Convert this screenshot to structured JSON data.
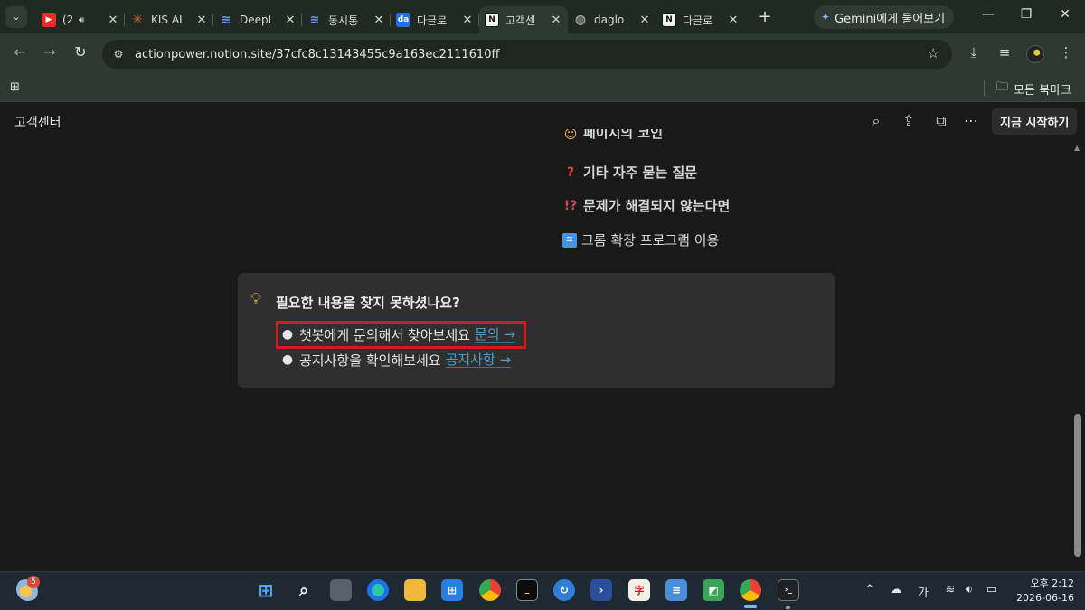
{
  "browser": {
    "tabs": [
      {
        "title": "(2",
        "favicon_color": "#e52d27",
        "favicon_glyph": "▶",
        "audio": true,
        "active": false
      },
      {
        "title": "KIS AI",
        "favicon_color": "#e0662b",
        "favicon_glyph": "✳",
        "audio": false,
        "active": false
      },
      {
        "title": "DeepL",
        "favicon_color": "#4a7fe0",
        "favicon_glyph": "≈",
        "audio": false,
        "active": false
      },
      {
        "title": "동시통",
        "favicon_color": "#4a7fe0",
        "favicon_glyph": "≈",
        "audio": false,
        "active": false
      },
      {
        "title": "다글로",
        "favicon_color": "#1e6fe8",
        "favicon_glyph": "da",
        "audio": false,
        "active": false
      },
      {
        "title": "고객센",
        "favicon_color": "#f2f2f2",
        "favicon_glyph": "N",
        "audio": false,
        "active": true
      },
      {
        "title": "daglo",
        "favicon_color": "#c9c9c9",
        "favicon_glyph": "◍",
        "audio": false,
        "active": false
      },
      {
        "title": "다글로",
        "favicon_color": "#f2f2f2",
        "favicon_glyph": "N",
        "audio": false,
        "active": false
      }
    ],
    "gemini_label": "Gemini에게 물어보기",
    "url": "actionpower.notion.site/37cfc8c13143455c9a163ec2111610ff",
    "all_bookmarks_label": "모든 북마크"
  },
  "page": {
    "title": "고객센터",
    "start_button": "지금 시작하기",
    "toc": [
      {
        "icon": "face-icon",
        "glyph": "☺",
        "label": "페이지의 코인",
        "color": "#e8b84a"
      },
      {
        "icon": "question-icon",
        "glyph": "❓",
        "label": "기타 자주 묻는 질문",
        "color": "#e04444"
      },
      {
        "icon": "exclamation-question-icon",
        "glyph": "⁉",
        "label": "문제가 해결되지 않는다면",
        "color": "#e04444"
      },
      {
        "icon": "signal-icon",
        "glyph": "ᯤ",
        "label": "크롬 확장 프로그램 이용",
        "color": "#4a90e2"
      }
    ],
    "callout": {
      "icon": "lightbulb-icon",
      "title": "필요한 내용을 찾지 못하셨나요?",
      "items": [
        {
          "text": "챗봇에게 문의해서 찾아보세요",
          "link": "문의 →"
        },
        {
          "text": "공지사항을 확인해보세요",
          "link": "공지사항 →"
        }
      ]
    }
  },
  "taskbar": {
    "weather_badge": "5",
    "ime": "가",
    "time": "오후 2:12",
    "date": "2026-06-16"
  }
}
